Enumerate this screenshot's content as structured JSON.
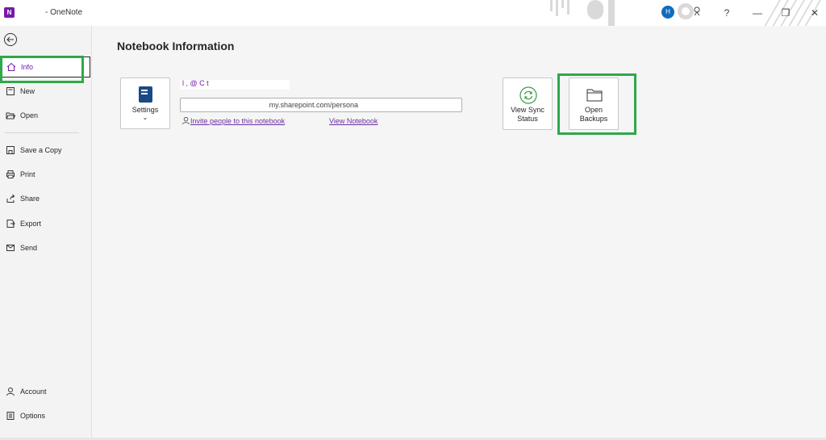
{
  "titlebar": {
    "app_icon": "N",
    "app_name": "- OneNote",
    "avatar_initial": "H",
    "help": "?",
    "minimize": "—",
    "restore": "❐",
    "close": "✕"
  },
  "sidebar": {
    "items": [
      {
        "label": "Info",
        "icon": "home-icon"
      },
      {
        "label": "New",
        "icon": "new-page-icon"
      },
      {
        "label": "Open",
        "icon": "folder-open-icon"
      },
      {
        "label": "Save a Copy",
        "icon": "save-copy-icon"
      },
      {
        "label": "Print",
        "icon": "print-icon"
      },
      {
        "label": "Share",
        "icon": "share-icon"
      },
      {
        "label": "Export",
        "icon": "export-icon"
      },
      {
        "label": "Send",
        "icon": "send-icon"
      },
      {
        "label": "Account",
        "icon": "person-icon"
      },
      {
        "label": "Options",
        "icon": "options-icon"
      }
    ]
  },
  "main": {
    "title": "Notebook Information",
    "settings_label": "Settings",
    "settings_chevron": "⌄",
    "notebook_name_fragment": "l    ,   @  C    t",
    "url": "my.sharepoint.com/persona",
    "invite_link": "Invite people to this notebook",
    "view_link": "View Notebook",
    "sync_label_1": "View Sync",
    "sync_label_2": "Status",
    "backups_label_1": "Open",
    "backups_label_2": "Backups"
  },
  "colors": {
    "accent": "#7719aa",
    "highlight": "#2ea84a",
    "avatar": "#0f6cbd"
  }
}
